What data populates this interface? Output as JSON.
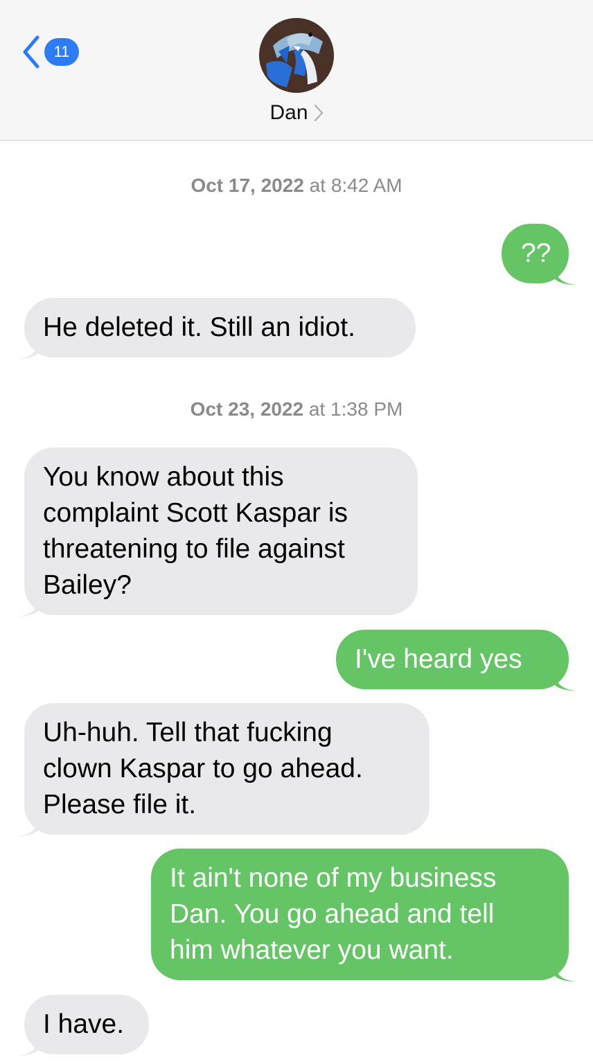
{
  "header": {
    "back_badge": "11",
    "contact_name": "Dan"
  },
  "colors": {
    "sent_bubble": "#65c466",
    "received_bubble": "#e9e9eb",
    "accent": "#2d7cf6"
  },
  "timestamps": [
    {
      "date": "Oct 17, 2022",
      "sep": "at",
      "time": "8:42 AM"
    },
    {
      "date": "Oct 23, 2022",
      "sep": "at",
      "time": "1:38 PM"
    }
  ],
  "messages": [
    {
      "from": "me",
      "lines": [
        "??"
      ]
    },
    {
      "from": "them",
      "lines": [
        "He deleted it. Still an idiot."
      ]
    },
    {
      "from": "them",
      "lines": [
        "You know about this",
        "complaint Scott Kaspar is",
        "threatening to file against",
        "Bailey?"
      ]
    },
    {
      "from": "me",
      "lines": [
        "I've heard yes"
      ]
    },
    {
      "from": "them",
      "lines": [
        "Uh-huh. Tell that fucking",
        "clown Kaspar to go ahead.",
        "Please file it."
      ]
    },
    {
      "from": "me",
      "lines": [
        "It ain't none of my business",
        "Dan.  You go ahead and tell",
        "him whatever you want."
      ]
    },
    {
      "from": "them",
      "lines": [
        "I have."
      ]
    }
  ]
}
